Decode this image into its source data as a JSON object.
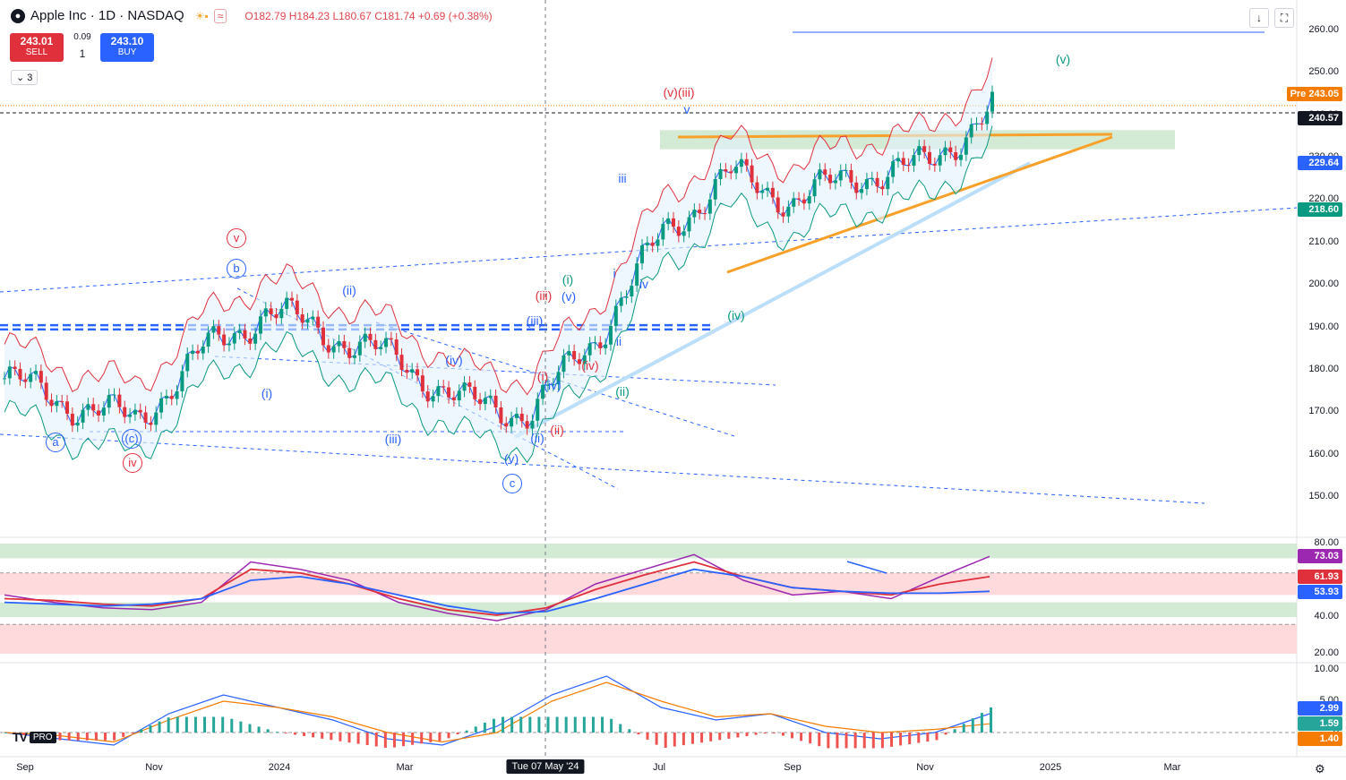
{
  "header": {
    "symbol": "Apple Inc · 1D · NASDAQ",
    "open": "O182.79",
    "high": "H184.23",
    "low": "L180.67",
    "close": "C181.74",
    "change": "+0.69 (+0.38%)"
  },
  "trade": {
    "sell_price": "243.01",
    "sell_label": "SELL",
    "buy_price": "243.10",
    "buy_label": "BUY",
    "spread": "0.09",
    "quantity": "1"
  },
  "indicators_toggle": "⌄ 3",
  "price_axis": {
    "ticks": [
      260,
      250,
      240,
      230,
      220,
      210,
      200,
      190,
      180,
      170,
      160,
      150
    ],
    "ymin": 145,
    "ymax": 265
  },
  "price_tags": [
    {
      "label": "Pre",
      "value": "243.05",
      "color": "#f57c00"
    },
    {
      "value": "240.57",
      "color": "#131722"
    },
    {
      "value": "229.64",
      "color": "#2962ff"
    },
    {
      "value": "218.60",
      "color": "#089981"
    }
  ],
  "rsi_axis": {
    "ticks": [
      "80.00",
      "60.00",
      "40.00",
      "20.00"
    ]
  },
  "rsi_tags": [
    {
      "value": "73.03",
      "color": "#9c27b0"
    },
    {
      "value": "61.93",
      "color": "#e0303c"
    },
    {
      "value": "53.93",
      "color": "#2962ff"
    }
  ],
  "macd_axis": {
    "ticks": [
      "10.00",
      "5.00",
      "0"
    ]
  },
  "macd_tags": [
    {
      "value": "2.99",
      "color": "#2962ff"
    },
    {
      "value": "1.59",
      "color": "#26a69a"
    },
    {
      "value": "1.40",
      "color": "#f57c00"
    }
  ],
  "time_axis": {
    "labels": [
      "Sep",
      "Nov",
      "2024",
      "Mar",
      "Jul",
      "Sep",
      "Nov",
      "2025",
      "Mar"
    ],
    "cursor_label": "Tue 07 May '24"
  },
  "wave_labels": [
    {
      "text": "a",
      "color": "#2962ff",
      "circle": true
    },
    {
      "text": "(c)",
      "color": "#2962ff",
      "circle": true
    },
    {
      "text": "iv",
      "color": "#e0303c",
      "circle": true
    },
    {
      "text": "v",
      "color": "#e0303c",
      "circle": true
    },
    {
      "text": "b",
      "color": "#2962ff",
      "circle": true
    },
    {
      "text": "(i)",
      "color": "#2962ff"
    },
    {
      "text": "(ii)",
      "color": "#2962ff"
    },
    {
      "text": "(iii)",
      "color": "#2962ff"
    },
    {
      "text": "(iv)",
      "color": "#2962ff"
    },
    {
      "text": "(v)",
      "color": "#2962ff"
    },
    {
      "text": "c",
      "color": "#2962ff",
      "circle": true
    },
    {
      "text": "(i)",
      "color": "#e0303c"
    },
    {
      "text": "(ii)",
      "color": "#e0303c"
    },
    {
      "text": "(iii)",
      "color": "#e0303c"
    },
    {
      "text": "(iv)",
      "color": "#e0303c"
    },
    {
      "text": "(ii)",
      "color": "#2962ff"
    },
    {
      "text": "(iii)",
      "color": "#2962ff"
    },
    {
      "text": "(iv)",
      "color": "#2962ff"
    },
    {
      "text": "(v)",
      "color": "#2962ff"
    },
    {
      "text": "(i)",
      "color": "#089981"
    },
    {
      "text": "(ii)",
      "color": "#089981"
    },
    {
      "text": "i",
      "color": "#2962ff"
    },
    {
      "text": "ii",
      "color": "#2962ff"
    },
    {
      "text": "iii",
      "color": "#2962ff"
    },
    {
      "text": "iv",
      "color": "#2962ff"
    },
    {
      "text": "(v)(iii)",
      "color": "#e0303c"
    },
    {
      "text": "v",
      "color": "#2962ff"
    },
    {
      "text": "(iv)",
      "color": "#089981"
    },
    {
      "text": "(v)",
      "color": "#089981"
    }
  ],
  "chart_data": [
    {
      "type": "candlestick",
      "title": "Apple Inc · 1D · NASDAQ",
      "x_range": [
        "Aug 2023",
        "Nov 2024"
      ],
      "ylim": [
        145,
        265
      ],
      "series": [
        {
          "name": "AAPL",
          "dates": [
            "Aug-23",
            "Sep-23",
            "Oct-23",
            "Nov-23",
            "Dec-23",
            "Jan-24",
            "Feb-24",
            "Mar-24",
            "Apr-24",
            "May-24",
            "Jun-24",
            "Jul-24",
            "Aug-24",
            "Sep-24",
            "Oct-24",
            "Nov-24"
          ],
          "close": [
            178,
            172,
            168,
            184,
            194,
            188,
            182,
            172,
            170,
            188,
            212,
            226,
            220,
            226,
            228,
            242
          ]
        }
      ],
      "levels": [
        {
          "price": 189.5,
          "style": "dashed-thick",
          "color": "#2962ff"
        },
        {
          "price": 190.5,
          "style": "dashed-thick",
          "color": "#2962ff"
        },
        {
          "price": 240.57,
          "style": "dashed",
          "color": "#131722"
        }
      ],
      "zones": [
        {
          "from": 232,
          "to": 236.5,
          "color": "#c8e6c9"
        }
      ]
    },
    {
      "type": "line",
      "title": "RSI",
      "ylim": [
        15,
        85
      ],
      "series": [
        {
          "values": [
            52,
            48,
            45,
            44,
            48,
            70,
            66,
            60,
            48,
            42,
            38,
            44,
            58,
            66,
            74,
            60,
            52,
            54,
            50,
            62,
            73
          ],
          "color": "#9c27b0"
        },
        {
          "values": [
            50,
            49,
            47,
            46,
            50,
            66,
            64,
            58,
            50,
            44,
            41,
            45,
            55,
            63,
            70,
            62,
            56,
            54,
            52,
            58,
            62
          ],
          "color": "#e0303c"
        },
        {
          "values": [
            48,
            47,
            46,
            47,
            50,
            60,
            62,
            58,
            52,
            46,
            42,
            43,
            50,
            58,
            66,
            62,
            56,
            54,
            53,
            53,
            54
          ],
          "color": "#2962ff"
        }
      ]
    },
    {
      "type": "line",
      "title": "MACD",
      "ylim": [
        -3,
        11
      ],
      "series": [
        {
          "values": [
            0,
            -1,
            -2,
            3,
            6,
            4,
            2,
            -1,
            -2,
            1,
            6,
            9,
            4,
            2,
            3,
            0,
            -1,
            0,
            3
          ],
          "color": "#2962ff"
        },
        {
          "values": [
            0,
            -0.5,
            -1.5,
            2,
            5,
            4,
            2.5,
            0,
            -1.5,
            0,
            5,
            8,
            5,
            2.5,
            3,
            1,
            0,
            0.5,
            1.4
          ],
          "color": "#f57c00"
        }
      ]
    }
  ]
}
